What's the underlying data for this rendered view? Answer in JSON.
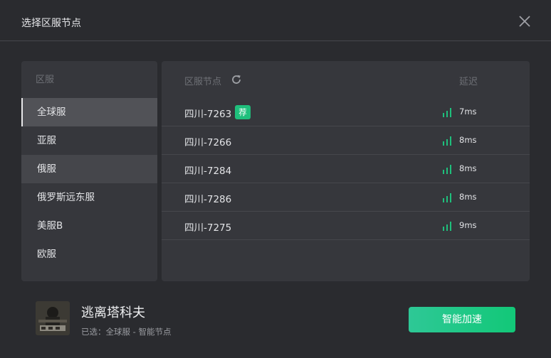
{
  "dialog": {
    "title": "选择区服节点"
  },
  "regions": {
    "header": "区服",
    "items": [
      {
        "label": "全球服",
        "state": "active"
      },
      {
        "label": "亚服",
        "state": ""
      },
      {
        "label": "俄服",
        "state": "hover"
      },
      {
        "label": "俄罗斯远东服",
        "state": ""
      },
      {
        "label": "美服B",
        "state": ""
      },
      {
        "label": "欧服",
        "state": ""
      }
    ]
  },
  "nodes": {
    "header": "区服节点",
    "latency_header": "延迟",
    "refresh_icon": "refresh-icon",
    "recommended_badge": "荐",
    "signal_color": "#1fbf7c",
    "items": [
      {
        "name": "四川-7263",
        "latency": "7ms",
        "recommended": true
      },
      {
        "name": "四川-7266",
        "latency": "8ms",
        "recommended": false
      },
      {
        "name": "四川-7284",
        "latency": "8ms",
        "recommended": false
      },
      {
        "name": "四川-7286",
        "latency": "8ms",
        "recommended": false
      },
      {
        "name": "四川-7275",
        "latency": "9ms",
        "recommended": false
      }
    ]
  },
  "game": {
    "name": "逃离塔科夫",
    "selection": "已选：全球服 - 智能节点"
  },
  "actions": {
    "accelerate_label": "智能加速"
  },
  "colors": {
    "background": "#2a2b2f",
    "panel": "#36373c",
    "accent": "#1fbf7c"
  }
}
